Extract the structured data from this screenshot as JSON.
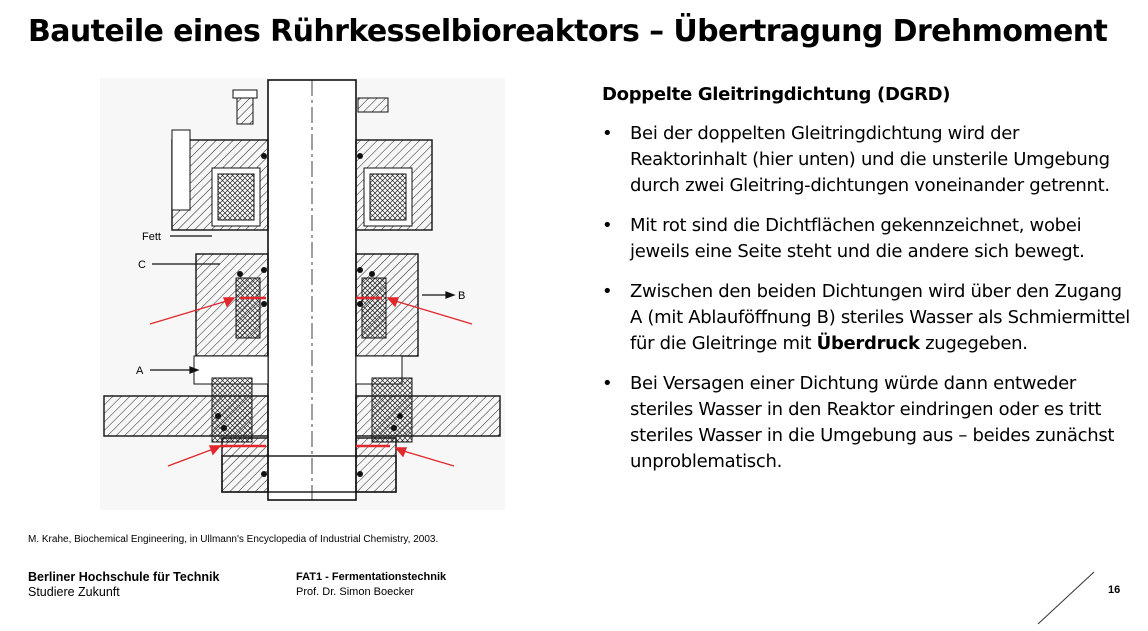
{
  "slide": {
    "title": "Bauteile eines Rührkesselbioreaktors – Übertragung Drehmoment",
    "subheading": "Doppelte Gleitringdichtung (DGRD)",
    "bullets": [
      {
        "text": "Bei der doppelten Gleitringdichtung wird der Reaktorinhalt (hier unten) und die unsterile Umgebung durch zwei Gleitring-dichtungen voneinander getrennt."
      },
      {
        "text": "Mit rot sind die Dichtflächen gekennzeichnet, wobei jeweils eine Seite steht und die andere sich bewegt."
      },
      {
        "text_before": "Zwischen den beiden Dichtungen wird über den Zugang A (mit Ablauföffnung B) steriles Wasser als Schmiermittel für die Gleitringe mit ",
        "text_bold": "Überdruck",
        "text_after": " zugegeben."
      },
      {
        "text": "Bei Versagen einer Dichtung würde dann entweder steriles Wasser in den Reaktor eindringen oder es tritt steriles Wasser in die Umgebung aus – beides zunächst unproblematisch."
      }
    ],
    "bullet_symbol": "•",
    "citation": "M. Krahe, Biochemical Engineering, in Ullmann's Encyclopedia of Industrial Chemistry, 2003.",
    "page_number": "16"
  },
  "diagram": {
    "labels": {
      "fett": "Fett",
      "c": "C",
      "a": "A",
      "b": "B"
    },
    "accent_color": "#e0282d"
  },
  "footer": {
    "brand_line1": "Berliner Hochschule für Technik",
    "brand_line2": "Studiere Zukunft",
    "course": "FAT1 - Fermentationstechnik",
    "author": "Prof. Dr. Simon Boecker"
  }
}
